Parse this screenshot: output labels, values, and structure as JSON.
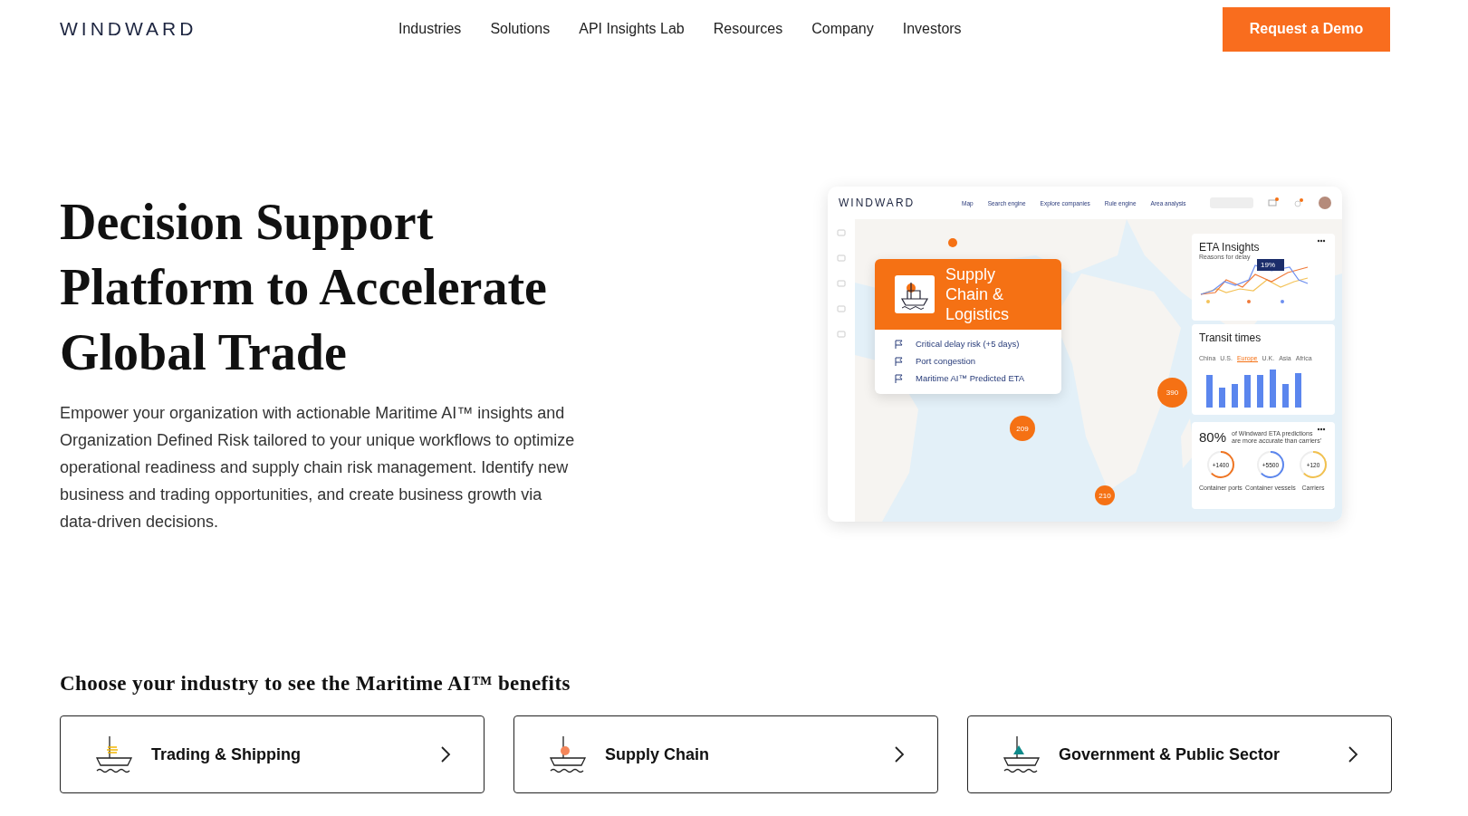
{
  "header": {
    "logo": "WINDWARD",
    "nav": [
      "Industries",
      "Solutions",
      "API Insights Lab",
      "Resources",
      "Company",
      "Investors"
    ],
    "cta": "Request a Demo"
  },
  "hero": {
    "title": "Decision Support Platform to Accelerate Global Trade",
    "body": "Empower your organization with actionable Maritime AI™ insights and Organization Defined Risk tailored to your unique workflows to optimize operational readiness and supply chain risk management. Identify new business and trading opportunities, and create business growth via data-driven decisions."
  },
  "mockup": {
    "logo": "WINDWARD",
    "nav": [
      "Map",
      "Search engine",
      "Explore companies",
      "Rule engine",
      "Area analysis"
    ],
    "popup": {
      "title": "Supply Chain & Logistics",
      "items": [
        "Critical delay risk (+5 days)",
        "Port congestion",
        "Maritime AI™ Predicted ETA"
      ]
    },
    "pins": [
      "390",
      "209",
      "210"
    ],
    "eta": {
      "title": "ETA Insights",
      "subtitle": "Reasons for delay",
      "callout": "19%"
    },
    "transit": {
      "title": "Transit times",
      "tabs": [
        {
          "label": "China",
          "selected": false
        },
        {
          "label": "U.S.",
          "selected": false
        },
        {
          "label": "Europe",
          "selected": true
        },
        {
          "label": "U.K.",
          "selected": false
        },
        {
          "label": "Asia",
          "selected": false
        },
        {
          "label": "Africa",
          "selected": false
        }
      ]
    },
    "accuracy": {
      "value": "80%",
      "caption": "of Windward ETA predictions are more accurate than carriers'",
      "rings": [
        {
          "value": "+1400",
          "label": "Container ports",
          "color": "#f07522"
        },
        {
          "value": "+5500",
          "label": "Container vessels",
          "color": "#5b86ee"
        },
        {
          "value": "+120",
          "label": "Carriers",
          "color": "#f2c14e"
        }
      ]
    }
  },
  "industries": {
    "heading": "Choose your industry to see the Maritime AI™ benefits",
    "cards": [
      {
        "label": "Trading & Shipping",
        "kind": "trading"
      },
      {
        "label": "Supply Chain",
        "kind": "supply"
      },
      {
        "label": "Government & Public Sector",
        "kind": "government"
      }
    ]
  }
}
